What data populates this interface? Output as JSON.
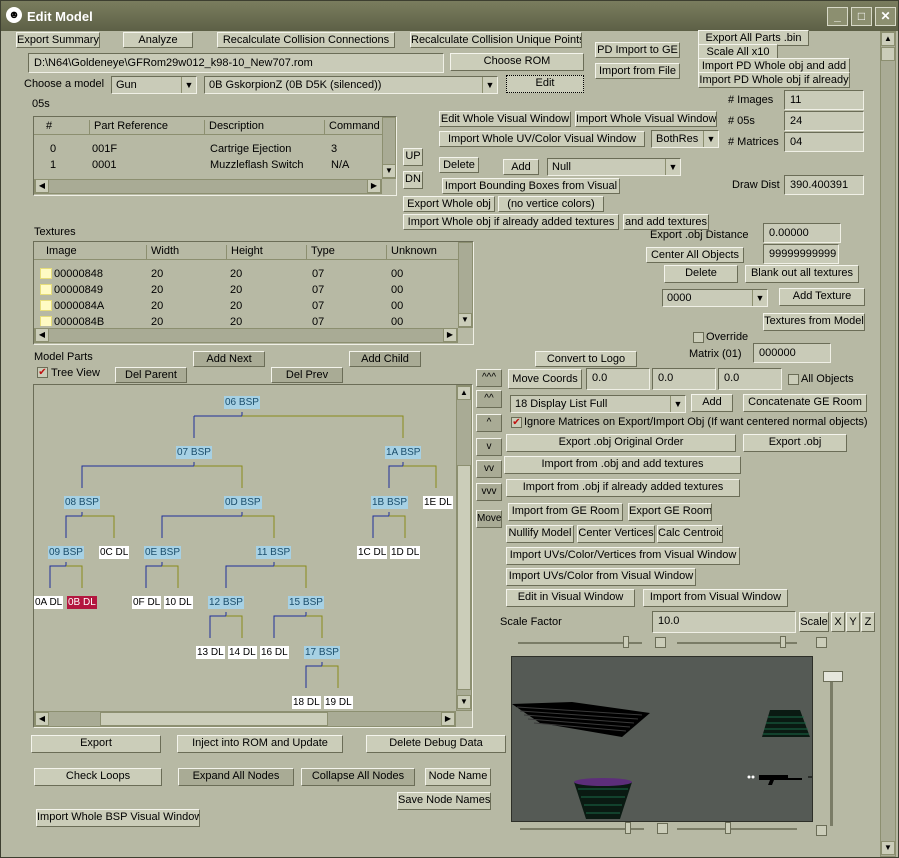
{
  "window": {
    "title": "Edit Model",
    "icon": "app-icon",
    "controls": [
      "_",
      "□",
      "✕"
    ]
  },
  "top": {
    "export_summary": "Export Summary",
    "analyze": "Analyze",
    "recalc_conn": "Recalculate Collision Connections",
    "recalc_unique": "Recalculate Collision Unique Points",
    "pd_import_ge": "PD Import to GE",
    "import_from_file": "Import from File",
    "export_all_parts": "Export All Parts .bin",
    "scale_all": "Scale All x10",
    "import_pd_add": "Import PD Whole obj and add",
    "import_pd_already": "Import PD Whole obj if already",
    "path": "D:\\N64\\Goldeneye\\GFRom29w012_k98-10_New707.rom",
    "choose_rom": "Choose ROM",
    "choose_model_label": "Choose a model",
    "model_type": "Gun",
    "model_name": "0B GskorpionZ (0B D5K (silenced))",
    "edit": "Edit"
  },
  "s05": {
    "label": "05s",
    "headers": [
      "#",
      "Part Reference",
      "Description",
      "Command"
    ],
    "rows": [
      [
        "0",
        "001F",
        "Cartrige Ejection",
        "3"
      ],
      [
        "1",
        "0001",
        "Muzzleflash Switch",
        "N/A"
      ]
    ],
    "up": "UP",
    "dn": "DN"
  },
  "mid": {
    "edit_whole_vis": "Edit Whole Visual Window",
    "import_whole_vis": "Import Whole Visual Window",
    "import_uv": "Import Whole UV/Color Visual Window",
    "bothres": "BothRes",
    "delete": "Delete",
    "add": "Add",
    "null": "Null",
    "import_bbox": "Import Bounding Boxes from Visual",
    "export_whole_obj": "Export Whole obj",
    "no_vert": "(no vertice colors)",
    "import_whole_already": "Import Whole obj if already added textures",
    "and_add": "and add textures"
  },
  "stats": {
    "images_label": "# Images",
    "images": "11",
    "s05_label": "# 05s",
    "s05": "24",
    "matrices_label": "# Matrices",
    "matrices": "04",
    "drawdist_label": "Draw Dist",
    "drawdist": "390.400391"
  },
  "textures": {
    "label": "Textures",
    "headers": [
      "Image",
      "Width",
      "Height",
      "Type",
      "Unknown"
    ],
    "rows": [
      [
        "00000848",
        "20",
        "20",
        "07",
        "00"
      ],
      [
        "00000849",
        "20",
        "20",
        "07",
        "00"
      ],
      [
        "0000084A",
        "20",
        "20",
        "07",
        "00"
      ],
      [
        "0000084B",
        "20",
        "20",
        "07",
        "00"
      ]
    ]
  },
  "right": {
    "export_obj_dist_label": "Export .obj Distance",
    "export_obj_dist": "0.00000",
    "center_all": "Center All Objects",
    "center_val": "99999999999",
    "delete": "Delete",
    "blank_textures": "Blank out all textures",
    "tex_combo": "0000",
    "add_texture": "Add Texture",
    "textures_from_model": "Textures from Model",
    "override": "Override",
    "matrix_label": "Matrix (01)",
    "matrix_val": "000000",
    "convert_logo": "Convert to Logo",
    "move_coords": "Move Coords",
    "mx": "0.0",
    "my": "0.0",
    "mz": "0.0",
    "all_objects": "All Objects",
    "display_list": "18 Display List Full",
    "add": "Add",
    "concat_ge": "Concatenate GE Room",
    "ignore_matrices": "Ignore Matrices on Export/Import Obj (If want centered normal objects)",
    "export_obj_orig": "Export .obj Original Order",
    "export_obj": "Export .obj",
    "import_obj_add": "Import from .obj and add textures",
    "import_obj_already": "Import from .obj if already added textures",
    "import_ge_room": "Import from GE Room",
    "export_ge_room": "Export GE Room",
    "nullify": "Nullify Model",
    "center_vertices": "Center Vertices",
    "calc_centroid": "Calc Centroid",
    "import_uv_vert": "Import UVs/Color/Vertices from Visual Window",
    "import_uv_color": "Import UVs/Color from Visual Window",
    "edit_visual": "Edit in Visual Window",
    "import_visual": "Import from Visual Window",
    "scale_label": "Scale Factor",
    "scale_val": "10.0",
    "scale": "Scale",
    "x": "X",
    "y": "Y",
    "z": "Z"
  },
  "parts": {
    "label": "Model Parts",
    "tree_view": "Tree View",
    "add_next": "Add Next",
    "add_child": "Add Child",
    "del_parent": "Del Parent",
    "del_prev": "Del Prev",
    "move_btns": [
      "^^^",
      "^^",
      "^",
      "v",
      "vv",
      "vvv",
      "Move"
    ],
    "nodes": {
      "n06": "06 BSP",
      "n07": "07 BSP",
      "n1A": "1A BSP",
      "n08": "08 BSP",
      "n0D": "0D BSP",
      "n1B": "1B BSP",
      "n1E": "1E DL",
      "n09": "09 BSP",
      "n0C": "0C DL",
      "n0E": "0E BSP",
      "n11": "11 BSP",
      "n1C": "1C DL",
      "n1D": "1D DL",
      "n0A": "0A DL",
      "n0B": "0B DL",
      "n0F": "0F DL",
      "n10": "10 DL",
      "n12": "12 BSP",
      "n15": "15 BSP",
      "n13": "13 DL",
      "n14": "14 DL",
      "n16": "16 DL",
      "n17": "17 BSP",
      "n18": "18 DL",
      "n19": "19 DL"
    }
  },
  "bottom": {
    "export": "Export",
    "inject": "Inject into ROM and Update",
    "delete_debug": "Delete Debug Data",
    "check_loops": "Check Loops",
    "expand_all": "Expand All Nodes",
    "collapse_all": "Collapse All Nodes",
    "node_name": "Node Name",
    "save_node_names": "Save Node Names",
    "import_bsp_visual": "Import Whole BSP Visual Window"
  },
  "colors": {
    "bsp": "#a7d1e4",
    "selected": "#b3163f",
    "line_blue": "#1f2f9a",
    "line_olive": "#8a8a1a"
  }
}
